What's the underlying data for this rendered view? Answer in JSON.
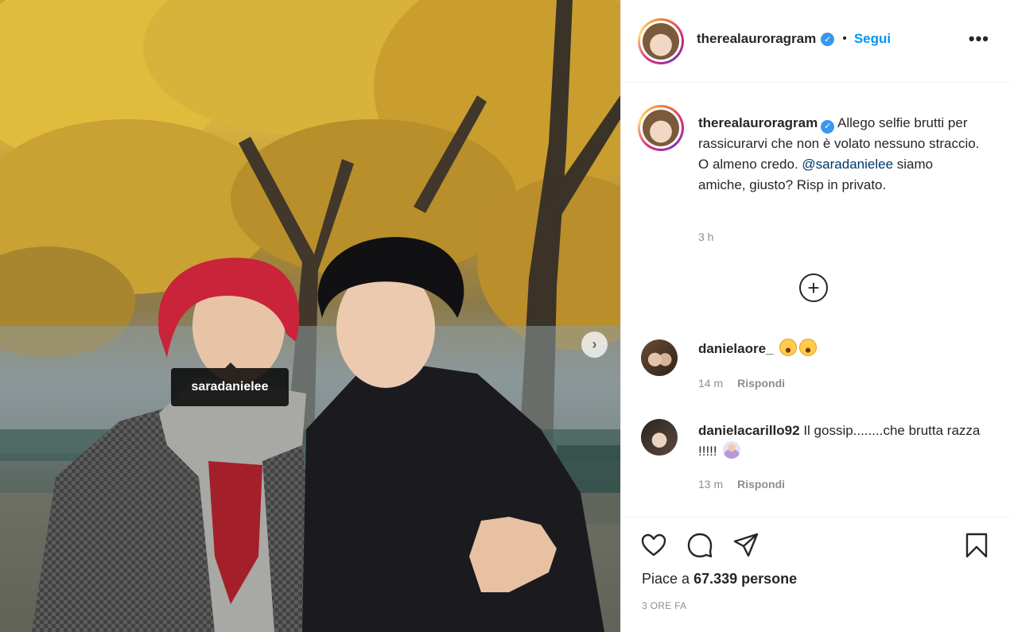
{
  "post": {
    "author": "therealauroragram",
    "follow_label": "Segui",
    "dot": "•",
    "more_label": "•••",
    "photo_tag": "saradanielee",
    "next_arrow": "›"
  },
  "caption": {
    "username": "therealauroragram",
    "text_1": "Allego selfie brutti per rassicurarvi che non è volato nessuno straccio. O almeno credo.",
    "mention": "@saradanielee",
    "text_2": "siamo amiche, giusto? Risp in privato.",
    "time": "3 h"
  },
  "load_more_icon": "plus-circle-icon",
  "comments": [
    {
      "username": "danielaore_",
      "text": "",
      "emoji": [
        "laugh-cry-emoji",
        "laugh-cry-emoji"
      ],
      "time": "14 m",
      "reply_label": "Rispondi"
    },
    {
      "username": "danielacarillo92",
      "text": "Il gossip........che brutta razza !!!!!",
      "emoji": [
        "person-facepalm-emoji"
      ],
      "time": "13 m",
      "reply_label": "Rispondi"
    }
  ],
  "actions": {
    "icons": [
      "heart-icon",
      "comment-icon",
      "share-icon",
      "bookmark-icon"
    ],
    "likes_prefix": "Piace a",
    "likes_count": "67.339",
    "likes_suffix": "persone",
    "post_time": "3 ORE FA"
  },
  "colors": {
    "accent": "#0095f6",
    "verified": "#3897f0",
    "mention": "#00376b",
    "muted": "#8e8e8e"
  }
}
